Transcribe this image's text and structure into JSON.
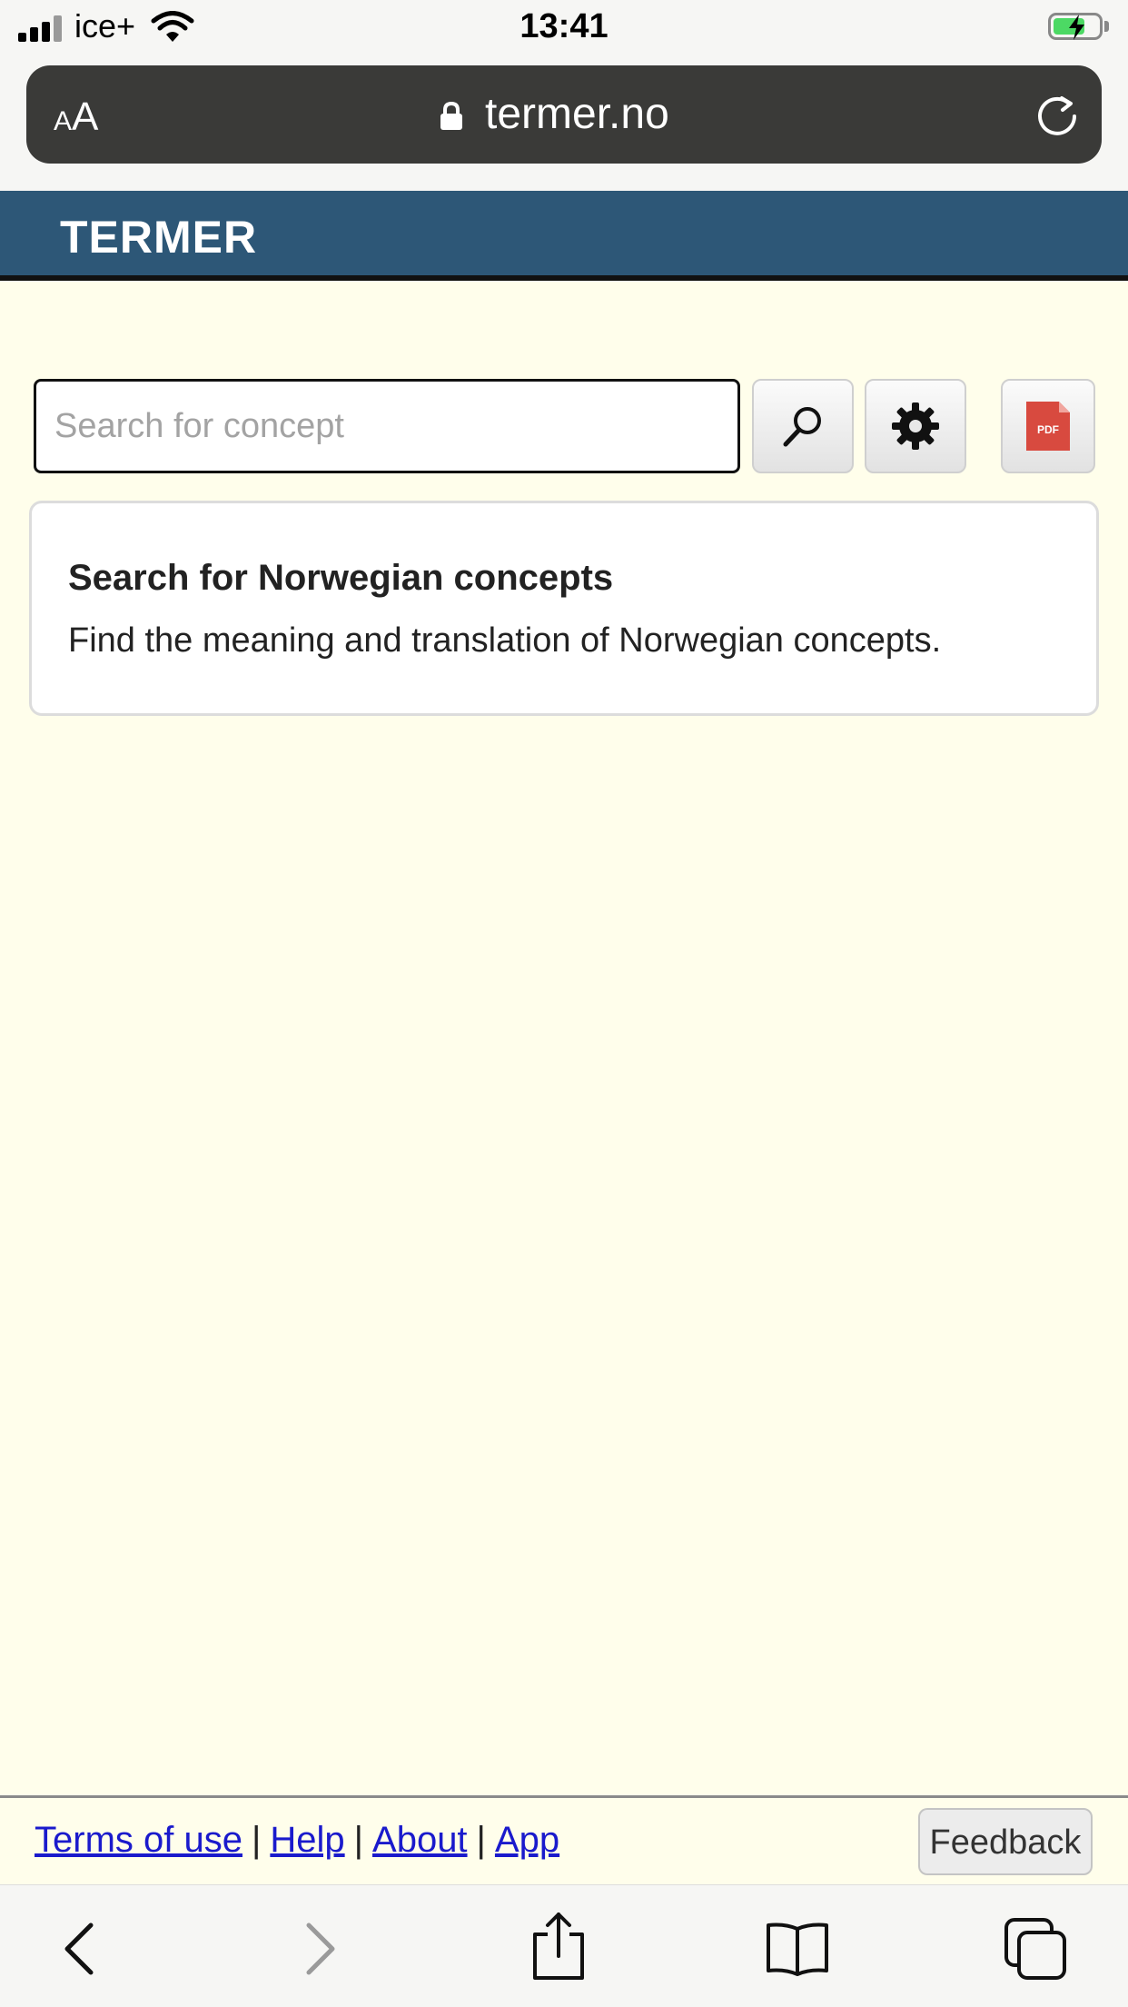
{
  "status_bar": {
    "carrier": "ice+",
    "time": "13:41"
  },
  "browser": {
    "aa_small": "A",
    "aa_large": "A",
    "domain": "termer.no"
  },
  "header": {
    "brand": "TERMER",
    "brand_color": "#2d5777"
  },
  "search": {
    "placeholder": "Search for concept",
    "value": "",
    "pdf_label": "PDF"
  },
  "info_card": {
    "title": "Search for Norwegian concepts",
    "text": "Find the meaning and translation of Norwegian concepts."
  },
  "footer": {
    "links": [
      "Terms of use",
      "Help",
      "About",
      "App"
    ],
    "separator": "|",
    "feedback_label": "Feedback"
  },
  "toolbar": {
    "icons": [
      "back-icon",
      "forward-icon",
      "share-icon",
      "bookmarks-icon",
      "tabs-icon"
    ]
  }
}
